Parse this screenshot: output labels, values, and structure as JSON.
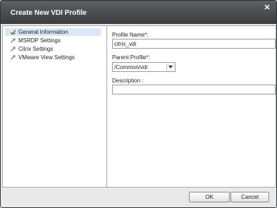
{
  "dialog": {
    "title": "Create New VDI Profile",
    "close_glyph": "✕"
  },
  "nav": {
    "items": [
      {
        "label": "General Information",
        "icon": "checkmark-icon",
        "selected": true
      },
      {
        "label": "MSRDP Settings",
        "icon": "pin-icon",
        "selected": false
      },
      {
        "label": "Citrix Settings",
        "icon": "pin-icon",
        "selected": false
      },
      {
        "label": "VMware View Settings",
        "icon": "pin-icon",
        "selected": false
      }
    ]
  },
  "form": {
    "profile_name_label": "Profile Name*:",
    "profile_name_value": "citrix_vdi",
    "parent_profile_label": "Parent Profile*:",
    "parent_profile_value": "/Common/vdi",
    "description_label": "Description :",
    "description_value": ""
  },
  "footer": {
    "ok_label": "OK",
    "cancel_label": "Cancel"
  },
  "colors": {
    "titlebar": "#3b3c3e",
    "selected_row": "#dbe7f8",
    "check_green": "#3a9a2a"
  }
}
